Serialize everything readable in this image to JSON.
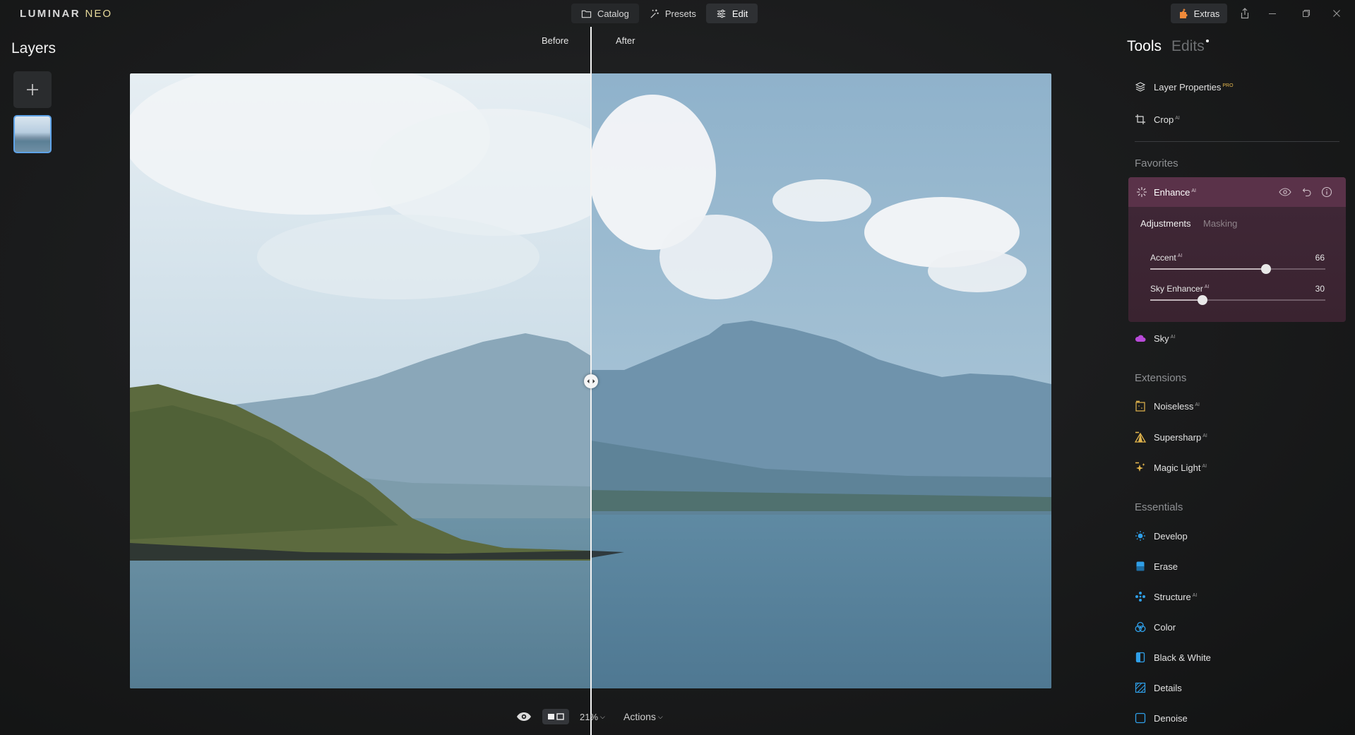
{
  "app": {
    "logo_main": "LUMINAR",
    "logo_accent": "NEO"
  },
  "modes": [
    {
      "label": "Catalog",
      "icon": "folder-icon"
    },
    {
      "label": "Presets",
      "icon": "sparkle-wand-icon"
    },
    {
      "label": "Edit",
      "icon": "sliders-icon",
      "active": true
    }
  ],
  "extras": {
    "label": "Extras",
    "icon": "puzzle-icon",
    "accent": "#f08a3a"
  },
  "layers": {
    "title": "Layers"
  },
  "canvas": {
    "before_label": "Before",
    "after_label": "After",
    "split_fraction": 0.499
  },
  "bottom": {
    "zoom": "21%",
    "actions": "Actions"
  },
  "panel": {
    "tools_tab": "Tools",
    "edits_tab": "Edits",
    "top_tools": [
      {
        "label": "Layer Properties",
        "badge": "PRO",
        "icon": "layers-icon"
      },
      {
        "label": "Crop",
        "badge": "AI",
        "icon": "crop-icon"
      }
    ],
    "favorites_title": "Favorites",
    "enhance": {
      "label": "Enhance",
      "badge": "AI",
      "tabs": [
        "Adjustments",
        "Masking"
      ],
      "sliders": [
        {
          "label": "Accent",
          "badge": "AI",
          "value": 66,
          "fraction": 0.66
        },
        {
          "label": "Sky Enhancer",
          "badge": "AI",
          "value": 30,
          "fraction": 0.3
        }
      ]
    },
    "sky": {
      "label": "Sky",
      "badge": "AI"
    },
    "extensions_title": "Extensions",
    "extensions": [
      {
        "label": "Noiseless",
        "badge": "AI",
        "icon": "noiseless-icon"
      },
      {
        "label": "Supersharp",
        "badge": "AI",
        "icon": "supersharp-icon"
      },
      {
        "label": "Magic Light",
        "badge": "AI",
        "icon": "magic-light-icon"
      }
    ],
    "essentials_title": "Essentials",
    "essentials": [
      {
        "label": "Develop",
        "badge": "",
        "icon": "sun-icon"
      },
      {
        "label": "Erase",
        "badge": "",
        "icon": "eraser-icon"
      },
      {
        "label": "Structure",
        "badge": "AI",
        "icon": "structure-icon"
      },
      {
        "label": "Color",
        "badge": "",
        "icon": "color-icon"
      },
      {
        "label": "Black & White",
        "badge": "",
        "icon": "black-white-icon"
      },
      {
        "label": "Details",
        "badge": "",
        "icon": "details-icon"
      },
      {
        "label": "Denoise",
        "badge": "",
        "icon": "denoise-icon"
      }
    ]
  }
}
